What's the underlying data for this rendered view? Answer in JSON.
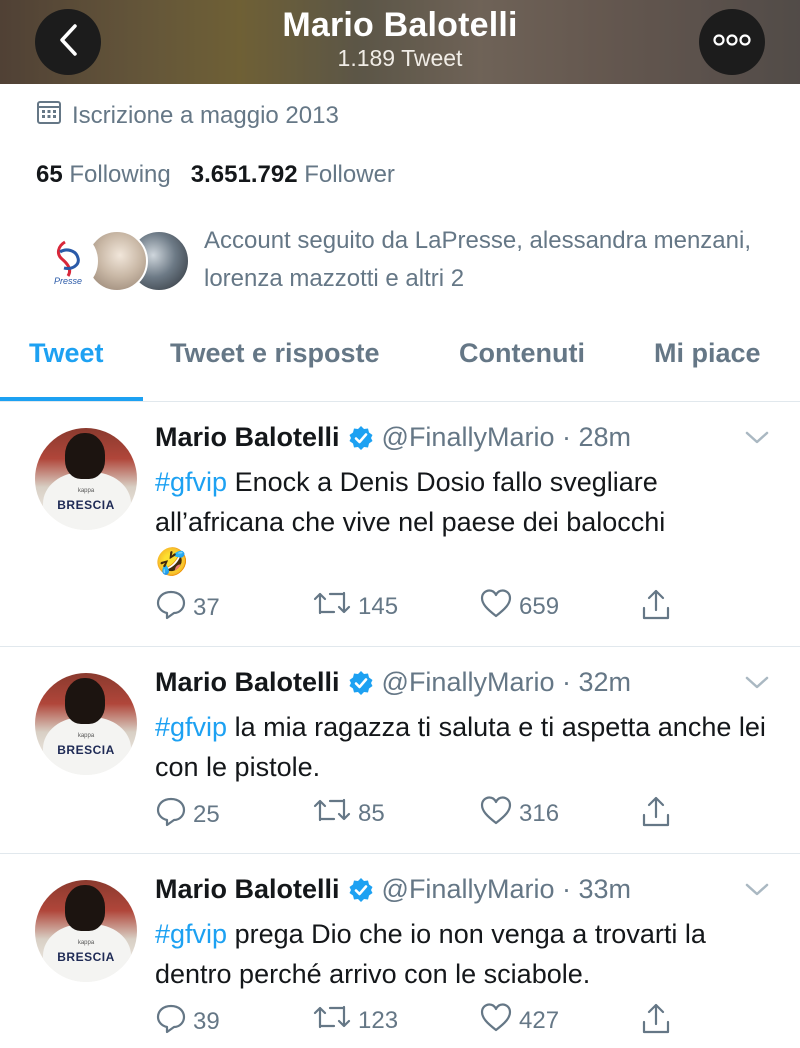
{
  "header": {
    "title": "Mario Balotelli",
    "subtitle": "1.189 Tweet"
  },
  "profile": {
    "joined": "Iscrizione a maggio 2013",
    "following_count": "65",
    "following_label": "Following",
    "follower_count": "3.651.792",
    "follower_label": "Follower",
    "followed_by_text": "Account seguito da LaPresse, alessandra menzani, lorenza mazzotti e altri 2",
    "followed_avatar_1_text": "Presse"
  },
  "tabs": [
    {
      "label": "Tweet",
      "active": true
    },
    {
      "label": "Tweet e risposte",
      "active": false
    },
    {
      "label": "Contenuti",
      "active": false
    },
    {
      "label": "Mi piace",
      "active": false
    }
  ],
  "tweets": [
    {
      "name": "Mario Balotelli",
      "handle": "@FinallyMario",
      "time": "28m",
      "hashtag": "#gfvip",
      "text": " Enock a Denis Dosio fallo svegliare all’africana che vive nel paese dei balocchi",
      "emoji": "🤣",
      "replies": "37",
      "retweets": "145",
      "likes": "659",
      "avatar_shirt": "BRESCIA"
    },
    {
      "name": "Mario Balotelli",
      "handle": "@FinallyMario",
      "time": "32m",
      "hashtag": "#gfvip",
      "text": " la mia ragazza ti saluta e ti aspetta anche lei con le pistole.",
      "emoji": "",
      "replies": "25",
      "retweets": "85",
      "likes": "316",
      "avatar_shirt": "BRESCIA"
    },
    {
      "name": "Mario Balotelli",
      "handle": "@FinallyMario",
      "time": "33m",
      "hashtag": "#gfvip",
      "text": " prega Dio che io non venga a trovarti la dentro perché arrivo con le sciabole.",
      "emoji": "",
      "replies": "39",
      "retweets": "123",
      "likes": "427",
      "avatar_shirt": "BRESCIA"
    }
  ],
  "colors": {
    "accent": "#1da1f2",
    "secondary_text": "#657786",
    "primary_text": "#14171a",
    "divider": "#e1e8ed"
  },
  "icons": {
    "back": "chevron-left-icon",
    "more": "more-dots-icon",
    "calendar": "calendar-icon",
    "verified": "verified-badge-icon",
    "caret": "chevron-down-icon",
    "reply": "reply-icon",
    "retweet": "retweet-icon",
    "like": "heart-icon",
    "share": "share-icon"
  }
}
